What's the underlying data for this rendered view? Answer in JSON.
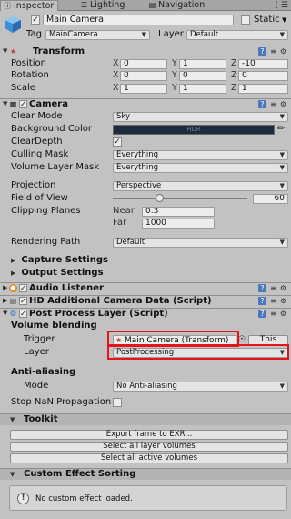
{
  "tabs": [
    {
      "label": "Inspector",
      "icon": "inspector-icon"
    },
    {
      "label": "Lighting",
      "icon": "lighting-icon"
    },
    {
      "label": "Navigation",
      "icon": "navigation-icon"
    }
  ],
  "gameobject": {
    "name": "Main Camera",
    "static_label": "Static",
    "tag_label": "Tag",
    "tag_value": "MainCamera",
    "layer_label": "Layer",
    "layer_value": "Default"
  },
  "transform": {
    "title": "Transform",
    "rows": [
      {
        "label": "Position",
        "x": "0",
        "y": "1",
        "z": "-10"
      },
      {
        "label": "Rotation",
        "x": "0",
        "y": "0",
        "z": "0"
      },
      {
        "label": "Scale",
        "x": "1",
        "y": "1",
        "z": "1"
      }
    ],
    "axes": {
      "x": "X",
      "y": "Y",
      "z": "Z"
    }
  },
  "camera": {
    "title": "Camera",
    "clear_mode_label": "Clear Mode",
    "clear_mode_value": "Sky",
    "background_color_label": "Background Color",
    "background_color_value": "HDR",
    "background_color": "#1d2b3e",
    "clear_depth_label": "ClearDepth",
    "culling_mask_label": "Culling Mask",
    "culling_mask_value": "Everything",
    "volume_layer_mask_label": "Volume Layer Mask",
    "volume_layer_mask_value": "Everything",
    "projection_label": "Projection",
    "projection_value": "Perspective",
    "fov_label": "Field of View",
    "fov_value": "60",
    "clipping_label": "Clipping Planes",
    "near_label": "Near",
    "near_value": "0.3",
    "far_label": "Far",
    "far_value": "1000",
    "rendering_path_label": "Rendering Path",
    "rendering_path_value": "Default",
    "capture_settings_label": "Capture Settings",
    "output_settings_label": "Output Settings"
  },
  "audio_listener": {
    "title": "Audio Listener"
  },
  "hd_camera": {
    "title": "HD Additional Camera Data (Script)"
  },
  "post_process": {
    "title": "Post Process Layer (Script)",
    "volume_blending_label": "Volume blending",
    "trigger_label": "Trigger",
    "trigger_value": "Main Camera (Transform)",
    "this_button": "This",
    "layer_label": "Layer",
    "layer_value": "PostProcessing",
    "anti_aliasing_label": "Anti-aliasing",
    "mode_label": "Mode",
    "mode_value": "No Anti-aliasing",
    "stop_nan_label": "Stop NaN Propagation",
    "toolkit_label": "Toolkit",
    "export_button": "Export frame to EXR...",
    "select_all_layer_button": "Select all layer volumes",
    "select_all_active_button": "Select all active volumes",
    "custom_effect_label": "Custom Effect Sorting",
    "no_custom_effect": "No custom effect loaded."
  },
  "colors": {
    "highlight": "#e3141a",
    "book_icon": "#4a78b8"
  }
}
